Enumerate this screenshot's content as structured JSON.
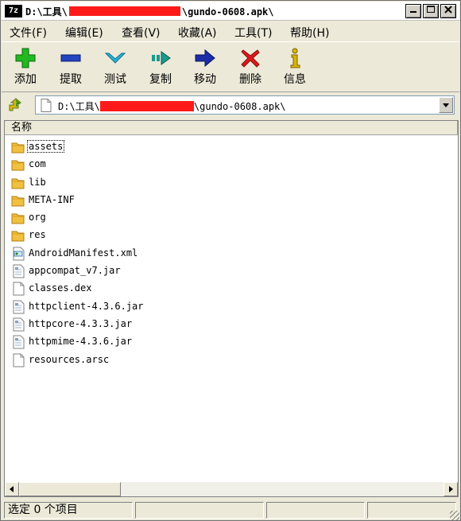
{
  "window": {
    "title_prefix": "D:\\工具\\",
    "title_suffix": "\\gundo-0608.apk\\",
    "app_icon_text": "7z",
    "controls": [
      "minimize",
      "maximize",
      "close"
    ]
  },
  "menu": [
    {
      "label": "文件(F)"
    },
    {
      "label": "编辑(E)"
    },
    {
      "label": "查看(V)"
    },
    {
      "label": "收藏(A)"
    },
    {
      "label": "工具(T)"
    },
    {
      "label": "帮助(H)"
    }
  ],
  "toolbar": [
    {
      "label": "添加",
      "icon": "add-icon",
      "color": "#18a818"
    },
    {
      "label": "提取",
      "icon": "extract-icon",
      "color": "#1c3cb8"
    },
    {
      "label": "测试",
      "icon": "test-icon",
      "color": "#1ea0c8"
    },
    {
      "label": "复制",
      "icon": "copy-icon",
      "color": "#1a9a8a"
    },
    {
      "label": "移动",
      "icon": "move-icon",
      "color": "#1c2ca8"
    },
    {
      "label": "删除",
      "icon": "delete-icon",
      "color": "#e01818"
    },
    {
      "label": "信息",
      "icon": "info-icon",
      "color": "#c8a800"
    }
  ],
  "address": {
    "prefix": "D:\\工具\\",
    "suffix": "\\gundo-0608.apk\\"
  },
  "list": {
    "column_name": "名称",
    "items": [
      {
        "name": "assets",
        "type": "folder"
      },
      {
        "name": "com",
        "type": "folder"
      },
      {
        "name": "lib",
        "type": "folder"
      },
      {
        "name": "META-INF",
        "type": "folder"
      },
      {
        "name": "org",
        "type": "folder"
      },
      {
        "name": "res",
        "type": "folder"
      },
      {
        "name": "AndroidManifest.xml",
        "type": "xml"
      },
      {
        "name": "appcompat_v7.jar",
        "type": "jar"
      },
      {
        "name": "classes.dex",
        "type": "file"
      },
      {
        "name": "httpclient-4.3.6.jar",
        "type": "jar"
      },
      {
        "name": "httpcore-4.3.3.jar",
        "type": "jar"
      },
      {
        "name": "httpmime-4.3.6.jar",
        "type": "jar"
      },
      {
        "name": "resources.arsc",
        "type": "file"
      }
    ]
  },
  "status": {
    "selected": "选定 0 个项目"
  }
}
